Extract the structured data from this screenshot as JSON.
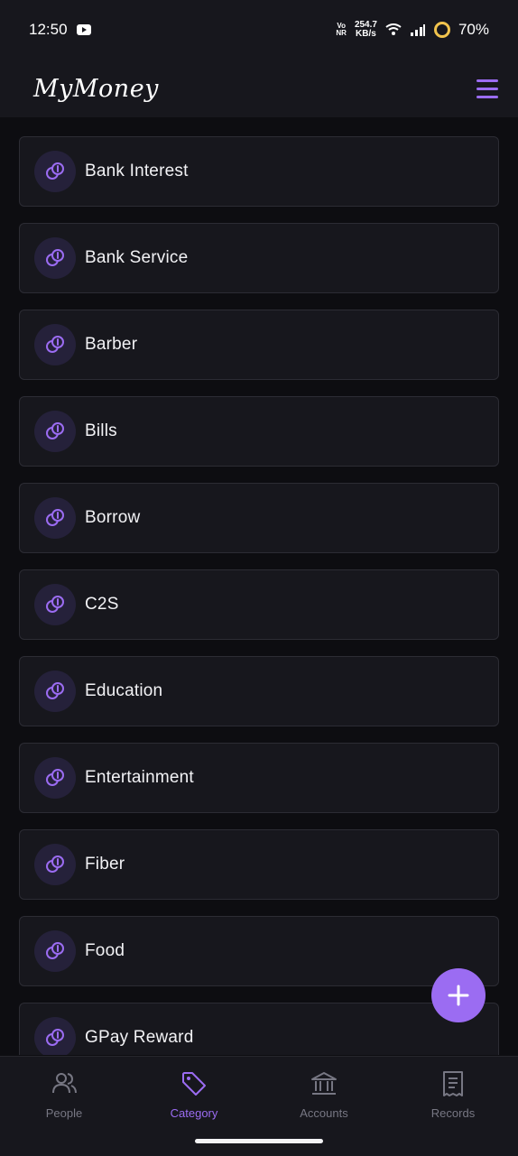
{
  "status_bar": {
    "time": "12:50",
    "network_label_top": "Vo",
    "network_label_bottom": "NR",
    "speed_value": "254.7",
    "speed_unit": "KB/s",
    "battery": "70%"
  },
  "header": {
    "app_name": "MyMoney",
    "accent_color": "#9b6cf2"
  },
  "categories": [
    {
      "label": "Bank Interest",
      "icon": "coins-icon"
    },
    {
      "label": "Bank Service",
      "icon": "coins-icon"
    },
    {
      "label": "Barber",
      "icon": "coins-icon"
    },
    {
      "label": "Bills",
      "icon": "coins-icon"
    },
    {
      "label": "Borrow",
      "icon": "coins-icon"
    },
    {
      "label": "C2S",
      "icon": "coins-icon"
    },
    {
      "label": "Education",
      "icon": "coins-icon"
    },
    {
      "label": "Entertainment",
      "icon": "coins-icon"
    },
    {
      "label": "Fiber",
      "icon": "coins-icon"
    },
    {
      "label": "Food",
      "icon": "coins-icon"
    },
    {
      "label": "GPay Reward",
      "icon": "coins-icon"
    }
  ],
  "fab": {
    "icon": "plus-icon"
  },
  "bottom_nav": {
    "items": [
      {
        "label": "People",
        "icon": "people-icon",
        "active": false
      },
      {
        "label": "Category",
        "icon": "tag-icon",
        "active": true
      },
      {
        "label": "Accounts",
        "icon": "bank-icon",
        "active": false
      },
      {
        "label": "Records",
        "icon": "receipt-icon",
        "active": false
      }
    ]
  }
}
